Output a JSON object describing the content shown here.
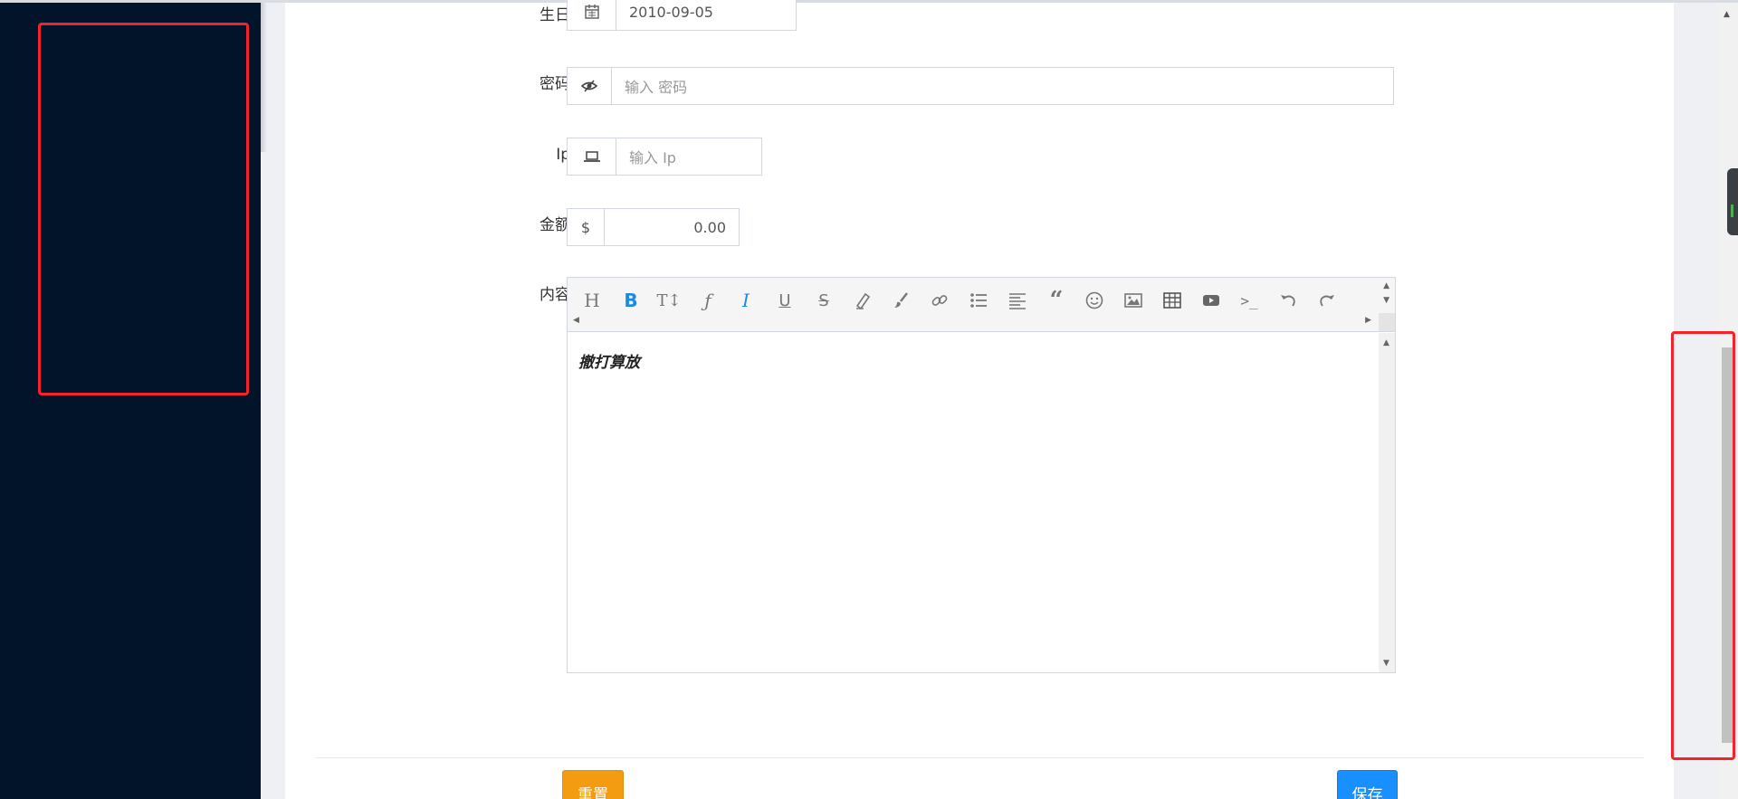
{
  "form": {
    "birthday": {
      "label": "生日",
      "icon": "calendar-icon",
      "value": "2010-09-05"
    },
    "password": {
      "label": "密码",
      "icon": "eye-slash-icon",
      "placeholder": "输入 密码"
    },
    "ip": {
      "label": "Ip",
      "icon": "laptop-icon",
      "placeholder": "输入 Ip"
    },
    "amount": {
      "label": "金额",
      "addon": "$",
      "value": "0.00"
    },
    "content": {
      "label": "内容",
      "text": "撤打算放",
      "toolbar": [
        "heading",
        "bold",
        "text-height",
        "font",
        "italic",
        "underline",
        "strikethrough",
        "eraser",
        "paintbrush",
        "link",
        "unordered-list",
        "align-left",
        "quote",
        "emoji",
        "image",
        "table",
        "video",
        "code",
        "undo",
        "redo"
      ]
    }
  },
  "buttons": {
    "reset": "重置",
    "save": "保存"
  },
  "colors": {
    "sidebar": "#021429",
    "annotation": "#f5222d",
    "reset": "#f39c12",
    "save": "#1890ff",
    "active_tool": "#1e88e5"
  }
}
